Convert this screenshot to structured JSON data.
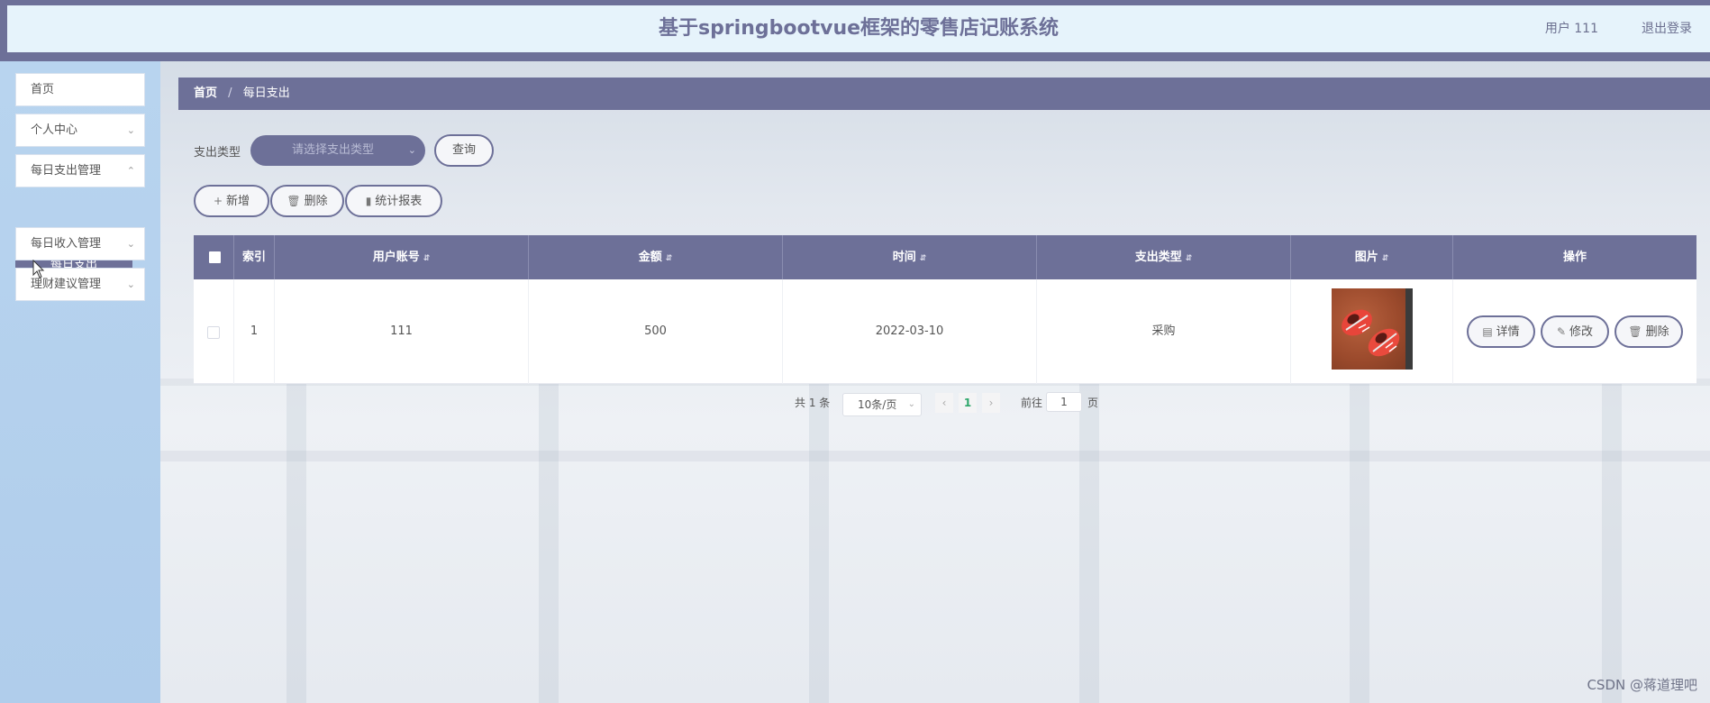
{
  "header": {
    "title": "基于springbootvue框架的零售店记账系统",
    "user": "用户 111",
    "logout": "退出登录"
  },
  "sidebar": {
    "items": [
      {
        "label": "首页"
      },
      {
        "label": "个人中心"
      },
      {
        "label": "每日支出管理"
      },
      {
        "label": "每日收入管理"
      },
      {
        "label": "理财建议管理"
      }
    ],
    "active_subitem": "每日支出"
  },
  "breadcrumb": {
    "home": "首页",
    "separator": "/",
    "current": "每日支出"
  },
  "search": {
    "label": "支出类型",
    "select_placeholder": "请选择支出类型",
    "query_button": "查询"
  },
  "toolbar": {
    "add": "新增",
    "delete": "删除",
    "stats": "统计报表"
  },
  "table": {
    "columns": [
      "索引",
      "用户账号",
      "金额",
      "时间",
      "支出类型",
      "图片",
      "操作"
    ],
    "rows": [
      {
        "index": "1",
        "account": "111",
        "amount": "500",
        "time": "2022-03-10",
        "type": "采购"
      }
    ],
    "actions": {
      "detail": "详情",
      "edit": "修改",
      "delete": "删除"
    }
  },
  "pagination": {
    "total": "共 1 条",
    "page_size": "10条/页",
    "current_page": "1",
    "goto_label": "前往",
    "goto_value": "1",
    "page_suffix": "页"
  },
  "watermark": "CSDN @蒋道理吧",
  "colors": {
    "accent": "#6d7098",
    "header_bg": "#e6f3fb",
    "sidebar_bg": "#b8d4ef",
    "active_page": "#2ea76b"
  },
  "icons": {
    "chevron": "chevron-down-icon",
    "plus": "plus-icon",
    "trash": "trash-icon",
    "chart": "bar-chart-icon",
    "document": "document-icon",
    "edit": "edit-icon",
    "sort": "sort-icon"
  }
}
